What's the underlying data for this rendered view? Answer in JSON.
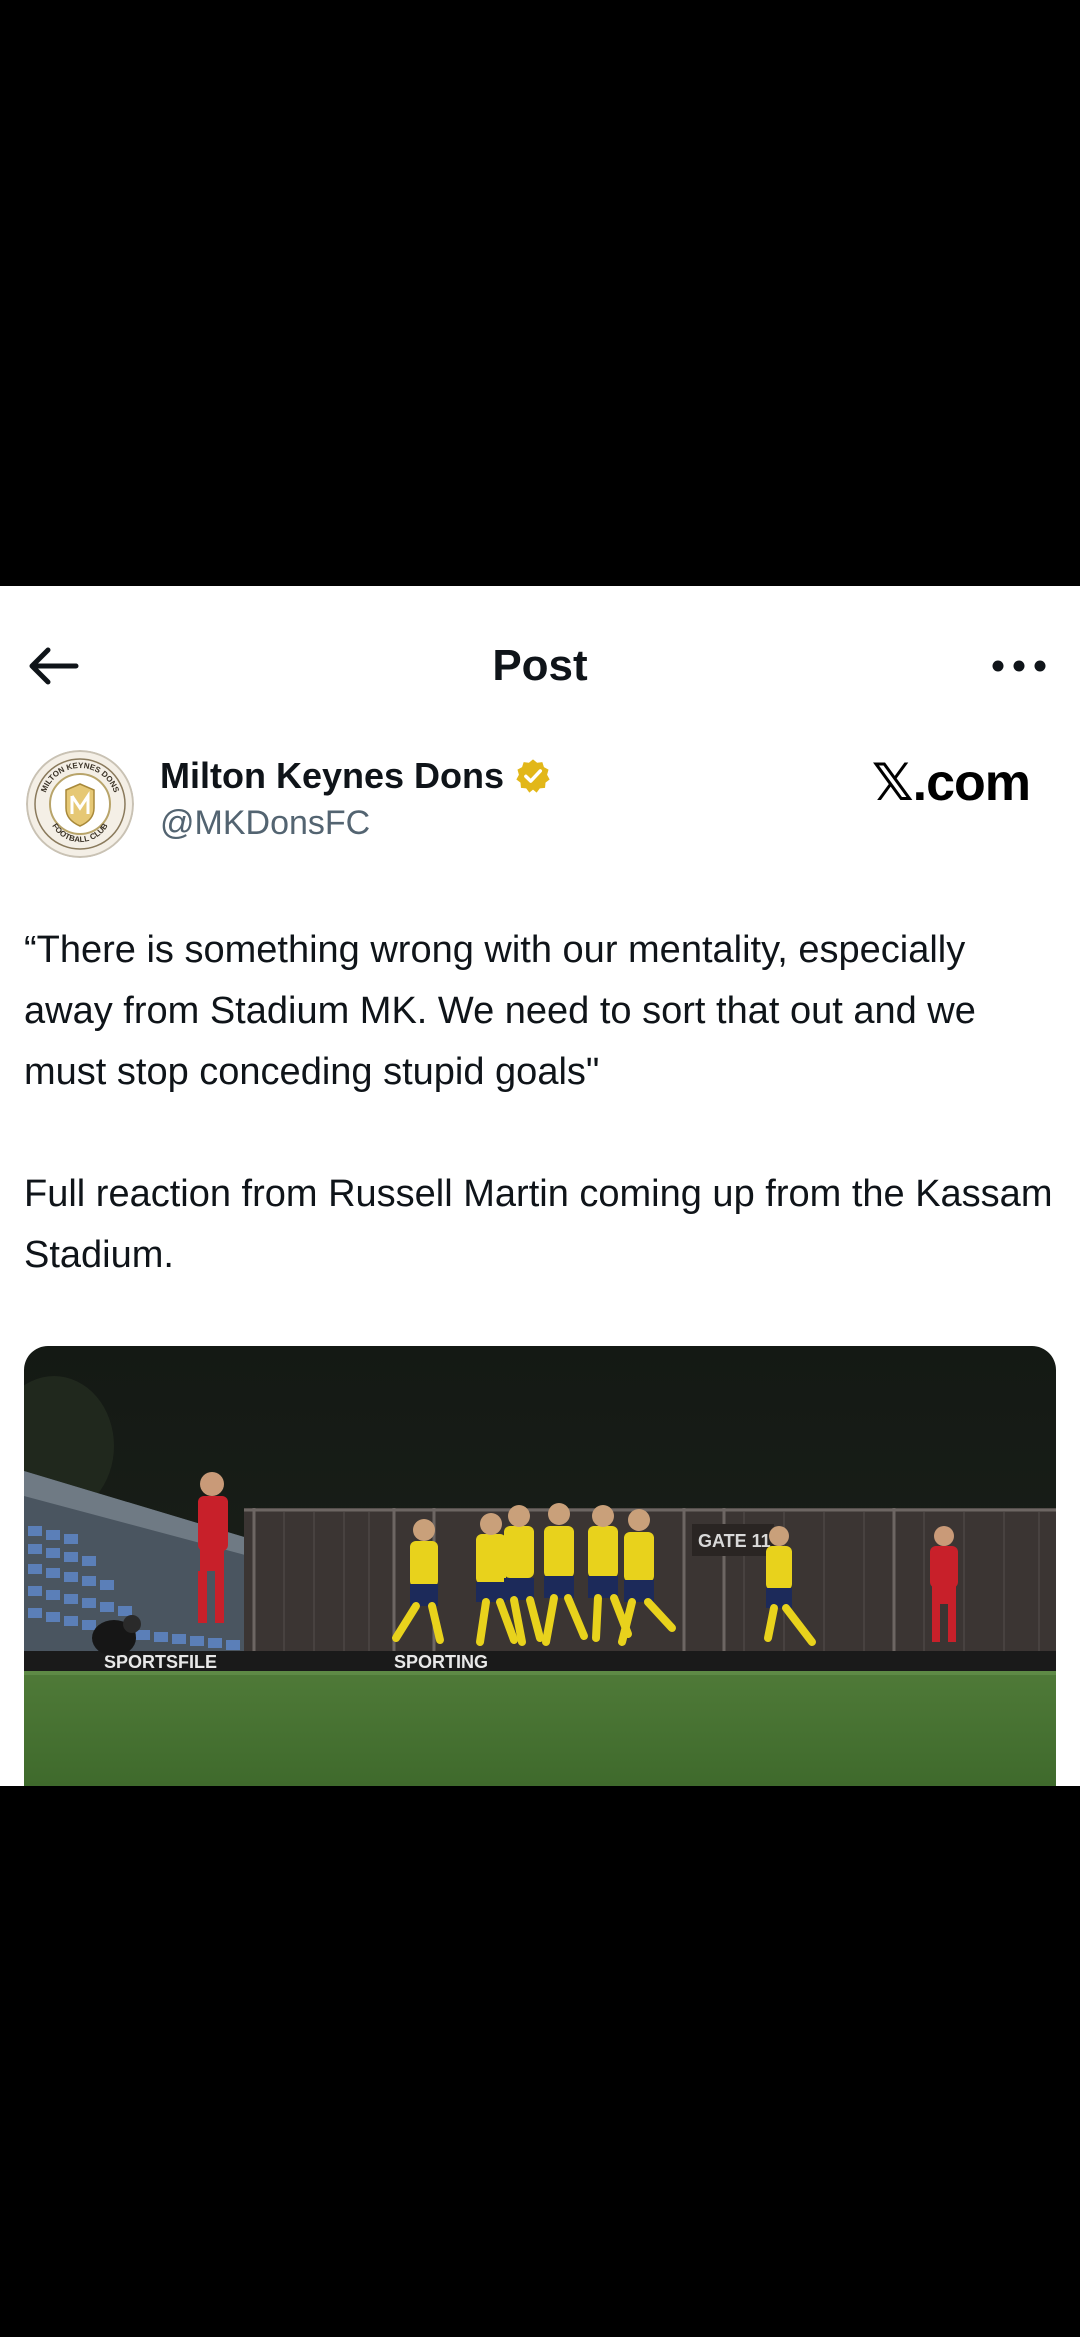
{
  "header": {
    "title": "Post",
    "back_icon": "arrow-left-icon",
    "more_icon": "more-horizontal-icon"
  },
  "author": {
    "name": "Milton Keynes Dons",
    "handle": "@MKDonsFC",
    "verified_icon": "verified-badge-icon",
    "verified_color": "#E2B719",
    "avatar_text_top": "MILTON KEYNES DONS",
    "avatar_text_bottom": "FOOTBALL CLUB"
  },
  "watermark": {
    "text": "𝕏.com"
  },
  "post": {
    "paragraphs": [
      "“There is something wrong with our mentality, especially away from Stadium MK. We need to sort that out and we must stop conceding stupid goals\"",
      "Full reaction from Russell Martin coming up from the Kassam Stadium."
    ]
  },
  "media": {
    "gate_sign": "GATE 11",
    "board_text_1": "SPORTSFILE",
    "board_text_2": "SPORTING"
  },
  "colors": {
    "text_primary": "#0f1419",
    "text_secondary": "#536471",
    "background": "#ffffff"
  }
}
